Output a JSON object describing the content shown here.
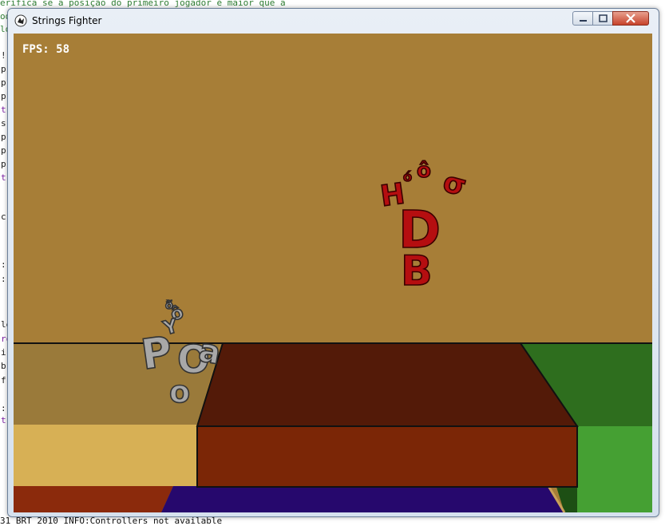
{
  "background_editor": {
    "top_line": "erifica se a posição do primeiro jogador é maior que a",
    "top_line_2": "od",
    "top_line_3": "lo",
    "bottom_line": "31 BRT 2010 INFO:Controllers not available",
    "left_fragments": [
      "!",
      "p",
      "p",
      "p",
      "t",
      "s",
      "p",
      "p",
      "p",
      "t",
      "c",
      ":",
      ":",
      "le",
      "ro",
      "i",
      "b",
      "f",
      ":",
      "t"
    ]
  },
  "window": {
    "title": "Strings Fighter",
    "icon": "app-icon",
    "controls": [
      "minimize-icon",
      "maximize-icon",
      "close-icon"
    ]
  },
  "game": {
    "fps_label": "FPS: 58",
    "colors": {
      "wall": "#a77e37",
      "floor_left_top": "#9a7a3a",
      "floor_left_front": "#d7b055",
      "platform_top": "#531a08",
      "platform_front": "#7b2606",
      "floor_right_top": "#2e6e1e",
      "floor_right_front": "#45a033",
      "floor_bottom_purple": "#26086d",
      "floor_bottom_red": "#8b2a0c",
      "player_one": "#a8a8a8",
      "player_two": "#b50e10"
    },
    "player_one_letters": "PODA",
    "player_two_letters": "DDB"
  }
}
